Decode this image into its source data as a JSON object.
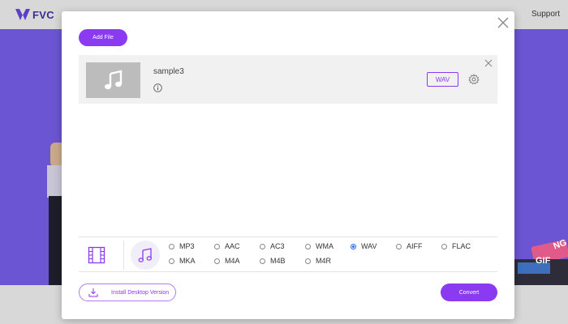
{
  "site": {
    "logo_text": "FVC",
    "support_link": "Support",
    "hero_deco": {
      "gif_text": "GIF",
      "png_text": "NG"
    }
  },
  "modal": {
    "add_file_label": "Add File",
    "file": {
      "name": "sample3",
      "format_badge": "WAV"
    },
    "formats": [
      {
        "label": "MP3",
        "selected": false
      },
      {
        "label": "AAC",
        "selected": false
      },
      {
        "label": "AC3",
        "selected": false
      },
      {
        "label": "WMA",
        "selected": false
      },
      {
        "label": "WAV",
        "selected": true
      },
      {
        "label": "AIFF",
        "selected": false
      },
      {
        "label": "FLAC",
        "selected": false
      },
      {
        "label": "MKA",
        "selected": false
      },
      {
        "label": "M4A",
        "selected": false
      },
      {
        "label": "M4B",
        "selected": false
      },
      {
        "label": "M4R",
        "selected": false
      }
    ],
    "install_label": "Install Desktop Version",
    "convert_label": "Convert"
  },
  "colors": {
    "accent": "#8a3af0",
    "hero_bg": "#6b55d2",
    "radio_selected": "#2a6ad8"
  }
}
